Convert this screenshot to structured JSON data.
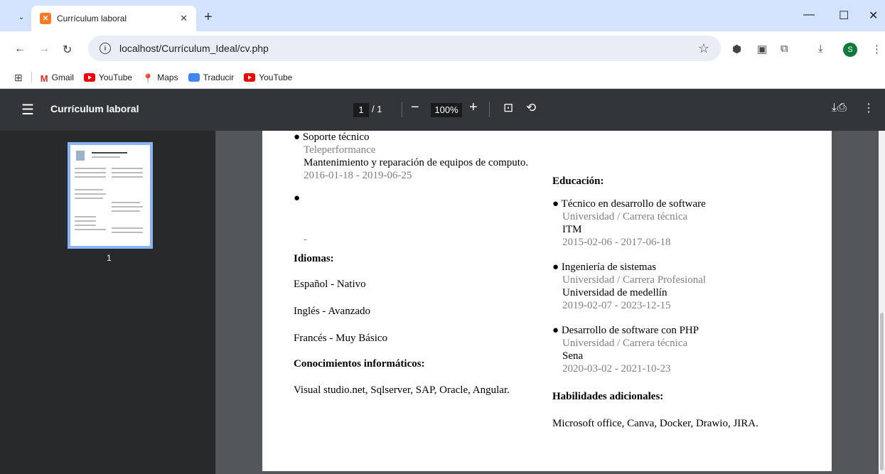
{
  "browser": {
    "tab_title": "Currículum laboral",
    "url": "localhost/Currículum_Ideal/cv.php",
    "profile_initial": "S",
    "bookmarks": [
      {
        "label": "Gmail",
        "icon": "gmail-icon"
      },
      {
        "label": "YouTube",
        "icon": "youtube-icon"
      },
      {
        "label": "Maps",
        "icon": "maps-icon"
      },
      {
        "label": "Traducir",
        "icon": "translate-icon"
      },
      {
        "label": "YouTube",
        "icon": "youtube-icon"
      }
    ]
  },
  "pdf_toolbar": {
    "title": "Currículum laboral",
    "current_page": "1",
    "total_pages": "/ 1",
    "zoom": "100%"
  },
  "thumbnail": {
    "page_label": "1"
  },
  "cv": {
    "experience_item1_title": "Soporte técnico",
    "experience_item1_company": "Teleperformance",
    "experience_item1_desc": "Mantenimiento y reparación de equipos de computo.",
    "experience_item1_dates": "2016-01-18  -  2019-06-25",
    "experience_item2_dates": "-",
    "languages_heading": "Idiomas:",
    "languages": [
      "Español  -  Nativo",
      "Inglés  -  Avanzado",
      "Francés  -  Muy Básico"
    ],
    "computing_heading": "Conocimientos informáticos:",
    "computing_text": "Visual studio.net, Sqlserver, SAP, Oracle, Angular.",
    "education_heading": "Educación:",
    "education": [
      {
        "title": "Técnico en desarrollo de software",
        "type": "Universidad / Carrera técnica",
        "institution": "ITM",
        "dates": "2015-02-06  -  2017-06-18"
      },
      {
        "title": "Ingeniería de sistemas",
        "type": "Universidad / Carrera Profesional",
        "institution": "Universidad de medellín",
        "dates": "2019-02-07  -  2023-12-15"
      },
      {
        "title": "Desarrollo de software con PHP",
        "type": "Universidad / Carrera técnica",
        "institution": "Sena",
        "dates": "2020-03-02  -  2021-10-23"
      }
    ],
    "skills_heading": "Habilidades adicionales:",
    "skills_text": "Microsoft office, Canva, Docker, Drawio, JIRA."
  }
}
